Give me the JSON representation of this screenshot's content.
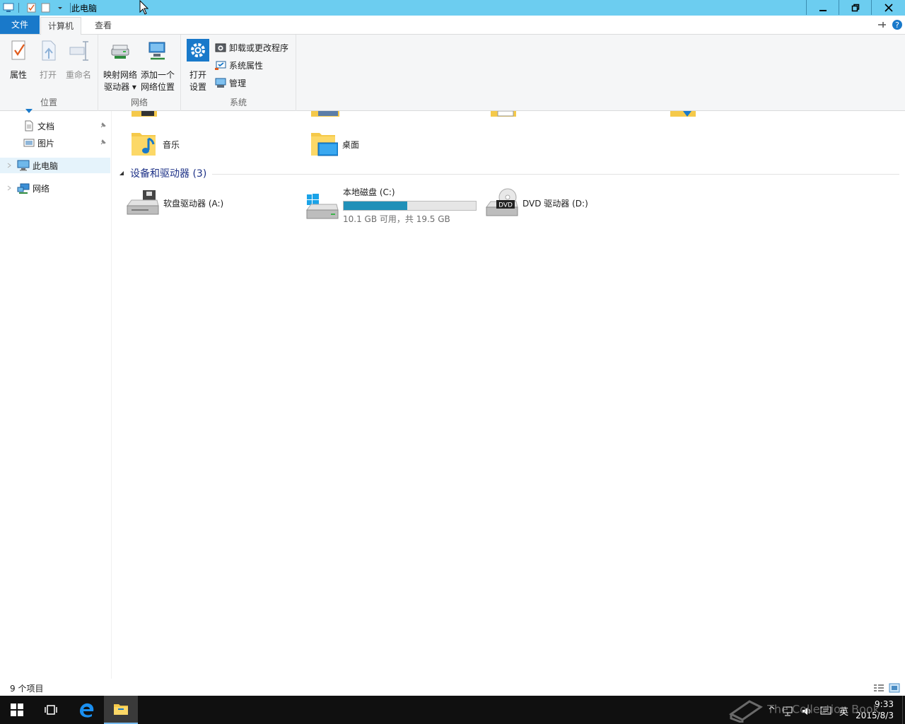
{
  "window": {
    "title": "此电脑"
  },
  "tabs": {
    "file": "文件",
    "computer": "计算机",
    "view": "查看"
  },
  "ribbon": {
    "location": {
      "label": "位置",
      "properties": "属性",
      "open": "打开",
      "rename": "重命名"
    },
    "network": {
      "label": "网络",
      "map_drive_line1": "映射网络",
      "map_drive_line2": "驱动器",
      "add_location_line1": "添加一个",
      "add_location_line2": "网络位置"
    },
    "system": {
      "label": "系统",
      "open_settings_line1": "打开",
      "open_settings_line2": "设置",
      "uninstall": "卸载或更改程序",
      "system_properties": "系统属性",
      "manage": "管理"
    }
  },
  "nav": {
    "items": [
      {
        "label": "文档"
      },
      {
        "label": "图片"
      },
      {
        "label": "此电脑"
      },
      {
        "label": "网络"
      }
    ]
  },
  "content": {
    "folders": [
      {
        "label": "音乐"
      },
      {
        "label": "桌面"
      }
    ],
    "devices_header": "设备和驱动器 (3)",
    "drives": {
      "floppy": "软盘驱动器 (A:)",
      "local_c": {
        "name": "本地磁盘 (C:)",
        "free_text": "10.1 GB 可用，共 19.5 GB",
        "used_fraction": 0.48
      },
      "dvd": "DVD 驱动器 (D:)"
    }
  },
  "status": {
    "item_count": "9 个项目"
  },
  "taskbar": {
    "lang": "英",
    "time": "9:33",
    "date": "2015/8/3"
  },
  "watermark": "The Collection Book"
}
